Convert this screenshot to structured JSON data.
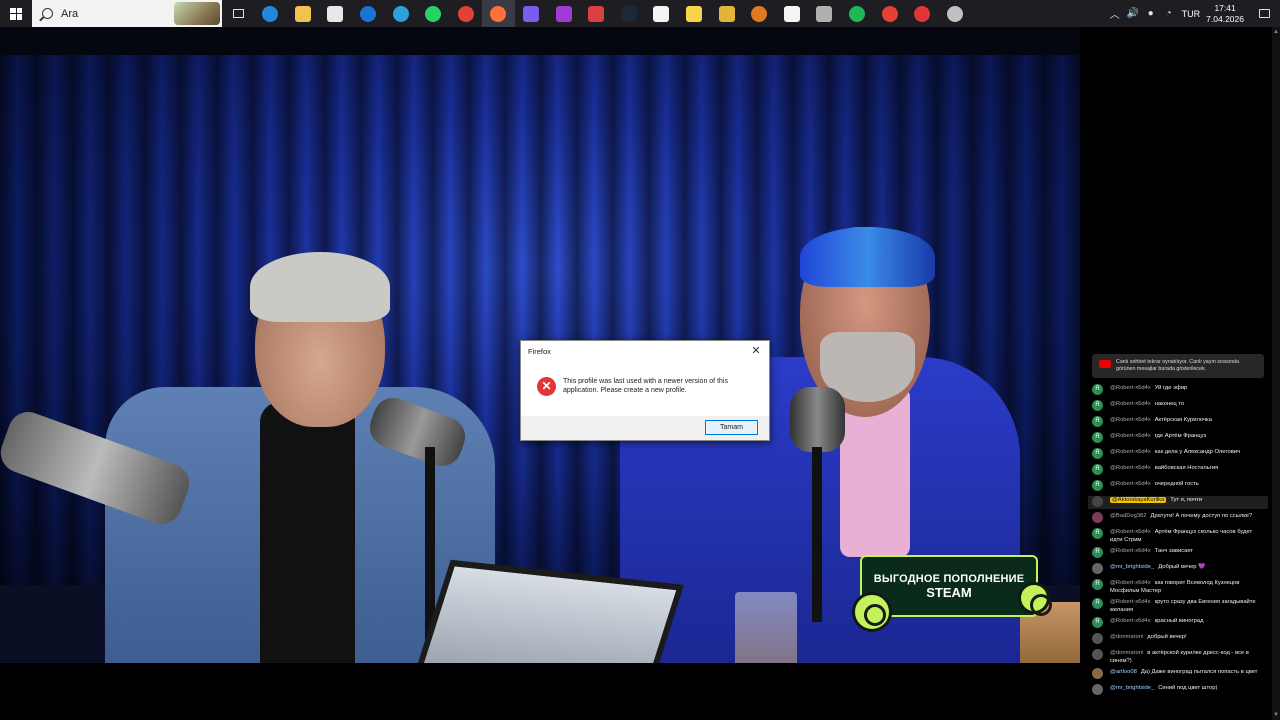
{
  "taskbar": {
    "search_placeholder": "Ara",
    "apps": [
      {
        "icon": "edge-icon",
        "color": "#1f8ad9"
      },
      {
        "icon": "file-explorer-icon",
        "color": "#f2c14e"
      },
      {
        "icon": "store-icon",
        "color": "#e8e8e8"
      },
      {
        "icon": "outlook-icon",
        "color": "#1a74d6"
      },
      {
        "icon": "telegram-icon",
        "color": "#2aa1da"
      },
      {
        "icon": "whatsapp-icon",
        "color": "#25d366"
      },
      {
        "icon": "chrome-icon",
        "color": "#e34133"
      },
      {
        "icon": "firefox-icon",
        "color": "#ff7139"
      },
      {
        "icon": "drop-app-icon",
        "color": "#7a5cf0"
      },
      {
        "icon": "clapper-app-icon",
        "color": "#a23bd6"
      },
      {
        "icon": "tools-app-icon",
        "color": "#d94040"
      },
      {
        "icon": "steam-icon",
        "color": "#1b2838"
      },
      {
        "icon": "document-icon",
        "color": "#f5f5f5"
      },
      {
        "icon": "sticky-notes-icon",
        "color": "#f7d54a"
      },
      {
        "icon": "puzzle-app-icon",
        "color": "#e2b43a"
      },
      {
        "icon": "shield-app-icon",
        "color": "#e07a1f"
      },
      {
        "icon": "blank-document-icon",
        "color": "#f5f5f5"
      },
      {
        "icon": "game-controller-icon",
        "color": "#b0b0b0"
      },
      {
        "icon": "spotify-icon",
        "color": "#1db954"
      },
      {
        "icon": "chrome-profile-icon",
        "color": "#e34133"
      },
      {
        "icon": "record-app-icon",
        "color": "#e23636"
      },
      {
        "icon": "ghost-app-icon",
        "color": "#c0c0c0"
      }
    ],
    "tray": {
      "language": "TUR",
      "time": "17:41",
      "date": "7.04.2026"
    }
  },
  "dialog": {
    "title": "Firefox",
    "message": "This profile was last used with a newer version of this application. Please create a new profile.",
    "ok_label": "Tamam"
  },
  "promo": {
    "line1": "ВЫГОДНОЕ ПОПОЛНЕНИЕ",
    "line2": "STEAM"
  },
  "chat": {
    "banner": "Canlı sohbet tekrar oynatılıyor. Canlı yayın sırasında görünen mesajlar burada gösterilecek.",
    "messages": [
      {
        "user": "@Robert-x6d4x",
        "text": "Уй где эфир",
        "avatar": "R",
        "color": "#2e8b57"
      },
      {
        "user": "@Robert-x6d4x",
        "text": "наконец то",
        "avatar": "R",
        "color": "#2e8b57"
      },
      {
        "user": "@Robert-x6d4x",
        "text": "Актёрская Курилочка",
        "avatar": "R",
        "color": "#2e8b57"
      },
      {
        "user": "@Robert-x6d4x",
        "text": "где Артём Француз",
        "avatar": "R",
        "color": "#2e8b57"
      },
      {
        "user": "@Robert-x6d4x",
        "text": "как дела у Александр Олегович",
        "avatar": "R",
        "color": "#2e8b57"
      },
      {
        "user": "@Robert-x6d4x",
        "text": "вайбовская Ностальгия",
        "avatar": "R",
        "color": "#2e8b57"
      },
      {
        "user": "@Robert-x6d4x",
        "text": "очередной гость",
        "avatar": "R",
        "color": "#2e8b57"
      },
      {
        "user": "@AktorskayaKurilka",
        "text": "Тут я, почти",
        "avatar": "",
        "color": "#444",
        "mod": true
      },
      {
        "user": "@BadDog382",
        "text": "Дратути! А почему доступ по ссылке?",
        "avatar": "",
        "color": "#7a3b5c"
      },
      {
        "user": "@Robert-x6d4x",
        "text": "Артём Француз сколько часов будет идти Стрим",
        "avatar": "R",
        "color": "#2e8b57"
      },
      {
        "user": "@Robert-x6d4x",
        "text": "Танч зависает",
        "avatar": "R",
        "color": "#2e8b57"
      },
      {
        "user": "@mr_brightside_",
        "text": "Добрый вечер 💜",
        "avatar": "",
        "color": "#666",
        "member": true
      },
      {
        "user": "@Robert-x6d4x",
        "text": "как говорит Всеволод Кузнецов Мосфильм Мастер",
        "avatar": "R",
        "color": "#2e8b57"
      },
      {
        "user": "@Robert-x6d4x",
        "text": "круто сразу два Евгения загадывайте желания",
        "avatar": "R",
        "color": "#2e8b57"
      },
      {
        "user": "@Robert-x6d4x",
        "text": "красный виноград",
        "avatar": "R",
        "color": "#2e8b57"
      },
      {
        "user": "@donmaroni",
        "text": "добрый вечер!",
        "avatar": "",
        "color": "#555"
      },
      {
        "user": "@donmaroni",
        "text": "в актёрской курилке дресс-код - все в синем?)",
        "avatar": "",
        "color": "#555"
      },
      {
        "user": "@artloo08",
        "text": "Да) Даже виноград пытался попасть в цвет",
        "avatar": "",
        "color": "#8a6a4a",
        "member": true
      },
      {
        "user": "@mr_brightside_",
        "text": "Синий под цвет штор)",
        "avatar": "",
        "color": "#666",
        "member": true
      }
    ]
  }
}
